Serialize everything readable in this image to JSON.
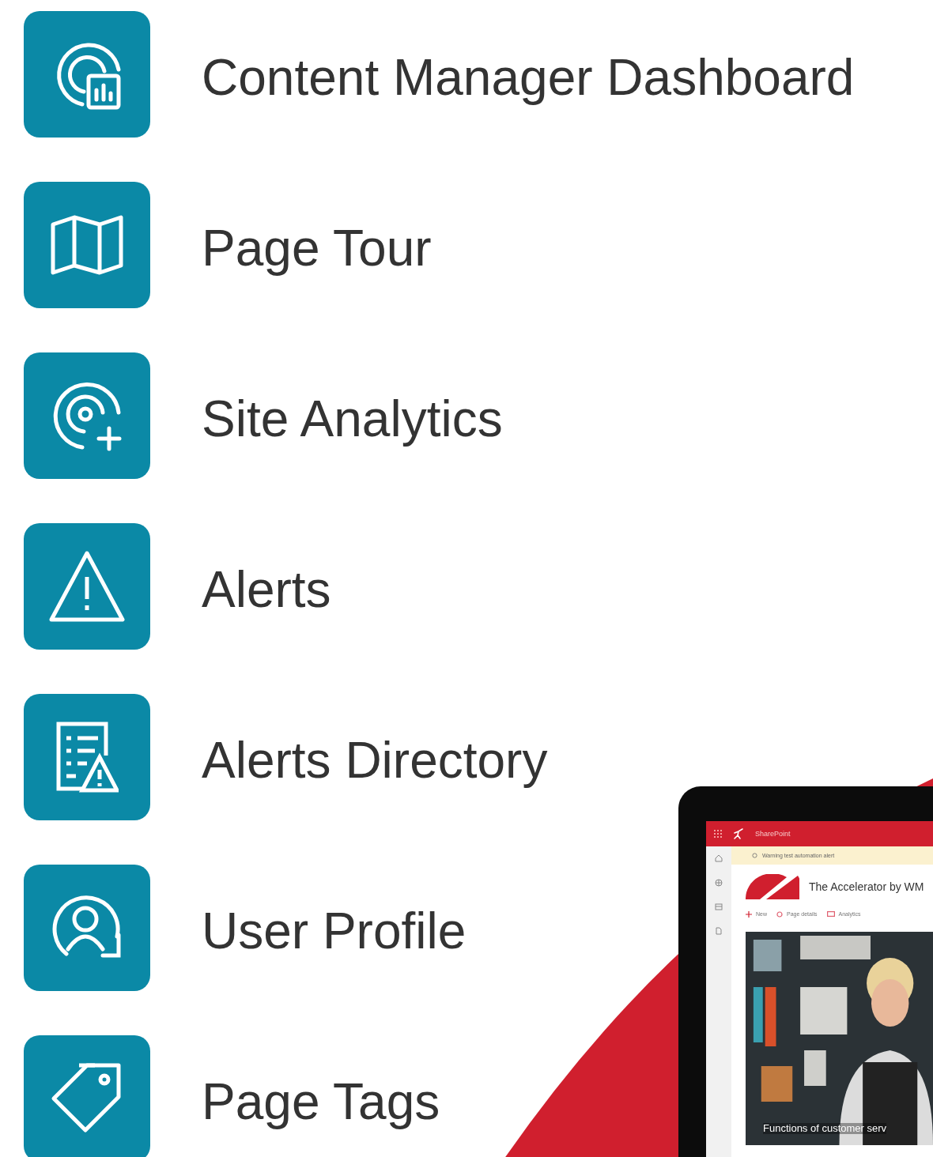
{
  "features": [
    {
      "label": "Content Manager Dashboard"
    },
    {
      "label": "Page Tour"
    },
    {
      "label": "Site Analytics"
    },
    {
      "label": "Alerts"
    },
    {
      "label": "Alerts Directory"
    },
    {
      "label": "User Profile"
    },
    {
      "label": "Page Tags"
    }
  ],
  "tablet": {
    "app_name": "SharePoint",
    "alert": "Warning test automation alert",
    "site_title": "The Accelerator by WM",
    "commands": [
      {
        "label": "New"
      },
      {
        "label": "Page details"
      },
      {
        "label": "Analytics"
      }
    ],
    "hero": {
      "kind": "picture",
      "caption": "Functions of customer serv"
    }
  }
}
